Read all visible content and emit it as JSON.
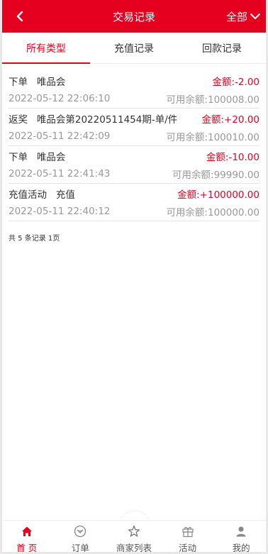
{
  "header": {
    "title": "交易记录",
    "filter_label": "全部",
    "accent_color": "#e6001f"
  },
  "tabs": [
    {
      "label": "所有类型",
      "active": true
    },
    {
      "label": "充值记录",
      "active": false
    },
    {
      "label": "回款记录",
      "active": false
    }
  ],
  "records": [
    {
      "type": "下单",
      "desc": "唯品会",
      "amount": "金额:-2.00",
      "time": "2022-05-12 22:06:10",
      "balance": "可用余额:100008.00"
    },
    {
      "type": "返奖",
      "desc": "唯品会第20220511454期-单/件",
      "amount": "金额:+20.00",
      "time": "2022-05-11 22:42:09",
      "balance": "可用余额:100010.00"
    },
    {
      "type": "下单",
      "desc": "唯品会",
      "amount": "金额:-10.00",
      "time": "2022-05-11 22:41:43",
      "balance": "可用余额:99990.00"
    },
    {
      "type": "充值活动",
      "desc": "充值",
      "amount": "金额:+100000.00",
      "time": "2022-05-11 22:40:12",
      "balance": "可用余额:100000.00"
    }
  ],
  "summary": "共 5 条记录 1页",
  "tabbar": [
    {
      "label": "首 页",
      "icon": "home-icon",
      "active": true
    },
    {
      "label": "订单",
      "icon": "order-icon",
      "active": false
    },
    {
      "label": "商家列表",
      "icon": "star-icon",
      "active": false
    },
    {
      "label": "活动",
      "icon": "gift-icon",
      "active": false
    },
    {
      "label": "我的",
      "icon": "user-icon",
      "active": false
    }
  ]
}
